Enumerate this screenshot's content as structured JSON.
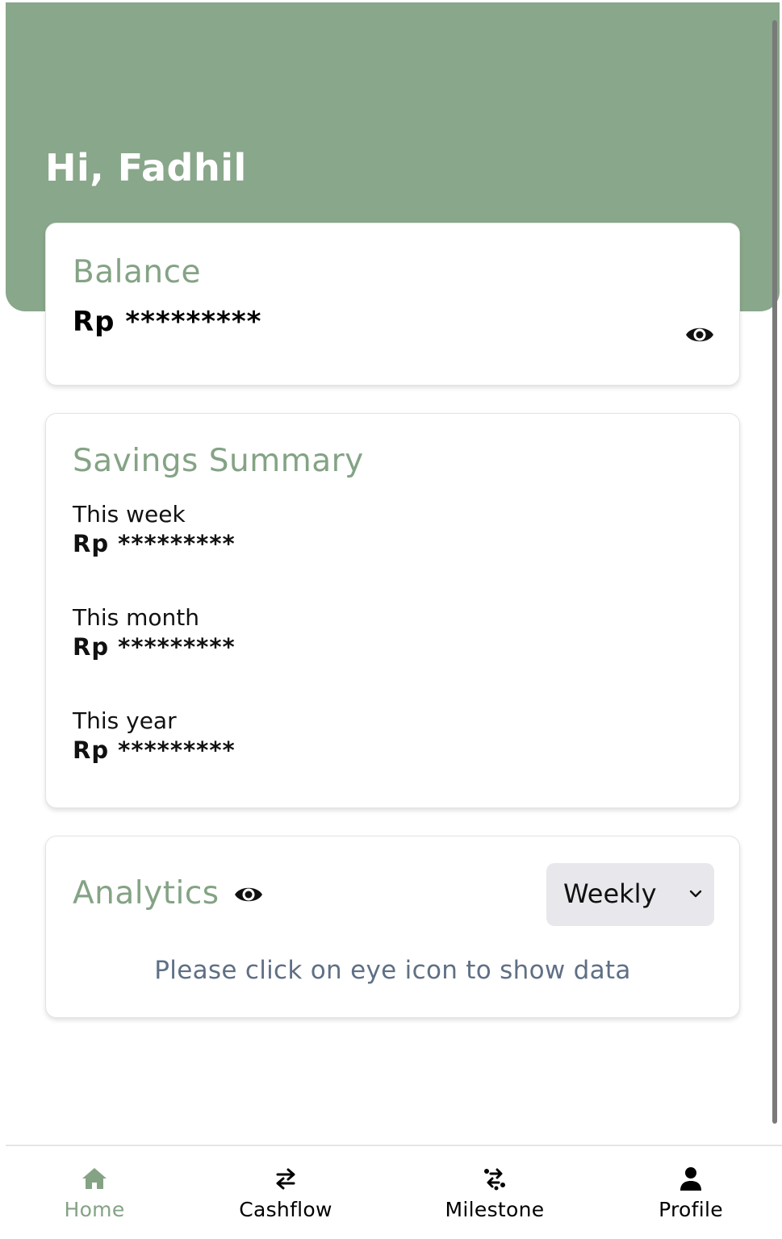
{
  "theme": {
    "header_color": "#89a78a",
    "accent_color": "#84a385",
    "muted_text_color": "#5f6f85"
  },
  "header": {
    "greeting": "Hi, Fadhil"
  },
  "balance": {
    "title": "Balance",
    "value": "Rp *********",
    "toggle_icon": "eye-icon"
  },
  "savings_summary": {
    "title": "Savings Summary",
    "items": [
      {
        "label": "This week",
        "value": "Rp *********"
      },
      {
        "label": "This month",
        "value": "Rp *********"
      },
      {
        "label": "This year",
        "value": "Rp *********"
      }
    ]
  },
  "analytics": {
    "title": "Analytics",
    "toggle_icon": "eye-icon",
    "period_selected": "Weekly",
    "empty_message": "Please click on eye icon to show data"
  },
  "bottom_nav": {
    "items": [
      {
        "label": "Home",
        "icon": "home-icon",
        "active": true
      },
      {
        "label": "Cashflow",
        "icon": "swap-arrows-icon",
        "active": false
      },
      {
        "label": "Milestone",
        "icon": "milestone-icon",
        "active": false
      },
      {
        "label": "Profile",
        "icon": "person-icon",
        "active": false
      }
    ]
  }
}
